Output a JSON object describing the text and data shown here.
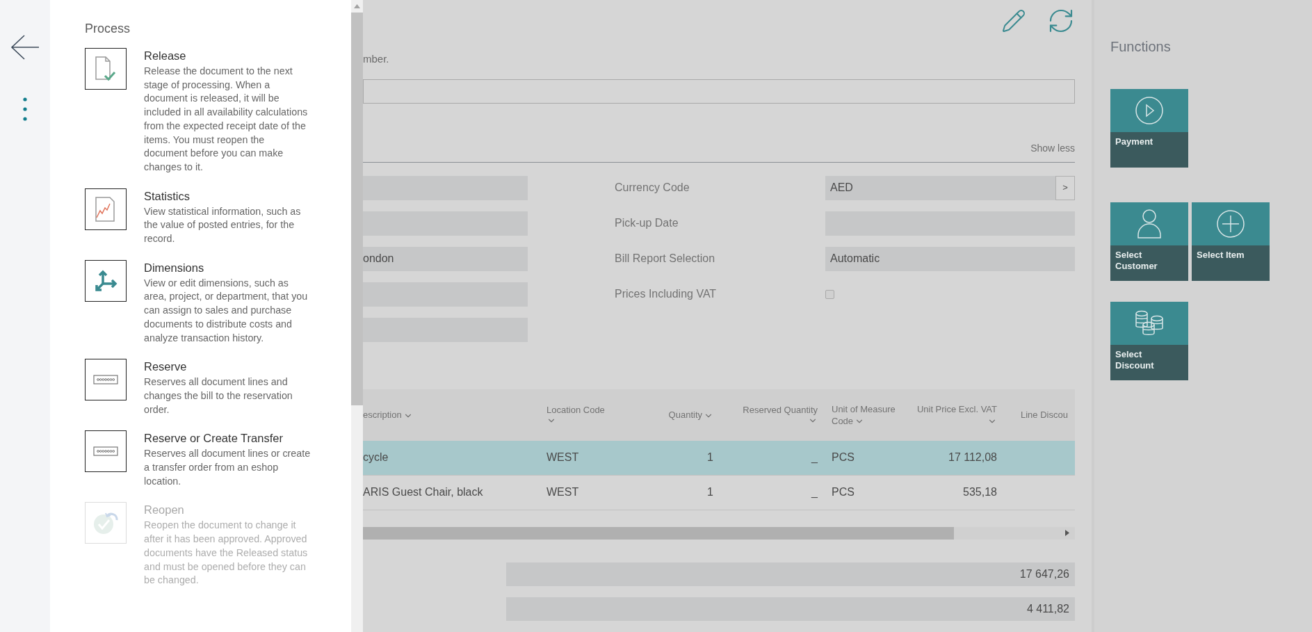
{
  "menu": {
    "title": "Process",
    "items": [
      {
        "kind": "release",
        "title": "Release",
        "description": "Release the document to the next stage of processing. When a document is released, it will be included in all availability calculations from the expected receipt date of the items. You must reopen the document before you can make changes to it.",
        "disabled": false
      },
      {
        "kind": "statistics",
        "title": "Statistics",
        "description": "View statistical information, such as the value of posted entries, for the record.",
        "disabled": false
      },
      {
        "kind": "dimensions",
        "title": "Dimensions",
        "description": "View or edit dimensions, such as area, project, or department, that you can assign to sales and purchase documents to distribute costs and analyze transaction history.",
        "disabled": false
      },
      {
        "kind": "reserve",
        "title": "Reserve",
        "description": "Reserves all document lines and changes the bill to the reservation order.",
        "disabled": false
      },
      {
        "kind": "reserve",
        "title": "Reserve or Create Transfer",
        "description": "Reserves all document lines or create a transfer order from an eshop location.",
        "disabled": false
      },
      {
        "kind": "reopen",
        "title": "Reopen",
        "description": "Reopen the document to change it after it has been approved. Approved documents have the Released status and must be opened before they can be changed.",
        "disabled": true
      }
    ]
  },
  "page": {
    "hint": "mber.",
    "show_less": "Show less",
    "left_fields": [
      {
        "kind": "text"
      },
      {
        "kind": "text"
      },
      {
        "kind": "text",
        "value": "ondon"
      },
      {
        "kind": "text"
      },
      {
        "kind": "text"
      }
    ],
    "right_fields": [
      {
        "kind": "lookup",
        "label": "Currency Code",
        "value": "AED",
        "button": ">"
      },
      {
        "kind": "text",
        "label": "Pick-up Date"
      },
      {
        "kind": "text",
        "label": "Bill Report Selection",
        "value": "Automatic"
      },
      {
        "kind": "checkbox",
        "label": "Prices Including VAT",
        "checked": false
      }
    ]
  },
  "table": {
    "columns": [
      {
        "label": "escription",
        "sort_menu": true
      },
      {
        "label": "Location Code",
        "sort_menu": true
      },
      {
        "label": "Quantity",
        "sort_menu": true
      },
      {
        "label": "Reserved Quantity",
        "sort_menu": true
      },
      {
        "label": "Unit of Measure Code",
        "sort_menu": true
      },
      {
        "label": "Unit Price Excl. VAT",
        "sort_menu": true
      },
      {
        "label": "Line Discou",
        "sort_menu": false
      }
    ],
    "rows": [
      {
        "selected": true,
        "cells": [
          "cycle",
          "WEST",
          "1",
          "_",
          "PCS",
          "17 112,08"
        ]
      },
      {
        "selected": false,
        "cells": [
          "ARIS Guest Chair, black",
          "WEST",
          "1",
          "_",
          "PCS",
          "535,18"
        ]
      }
    ]
  },
  "totals": [
    "17 647,26",
    "4 411,82"
  ],
  "functions": {
    "title": "Functions",
    "groups": [
      {
        "tiles": [
          {
            "kind": "payment",
            "label": "Payment"
          }
        ]
      },
      {
        "tiles": [
          {
            "kind": "customer",
            "label": "Select Customer"
          },
          {
            "kind": "item",
            "label": "Select Item"
          }
        ]
      },
      {
        "tiles": [
          {
            "kind": "discount",
            "label": "Select Discount"
          }
        ]
      }
    ]
  }
}
